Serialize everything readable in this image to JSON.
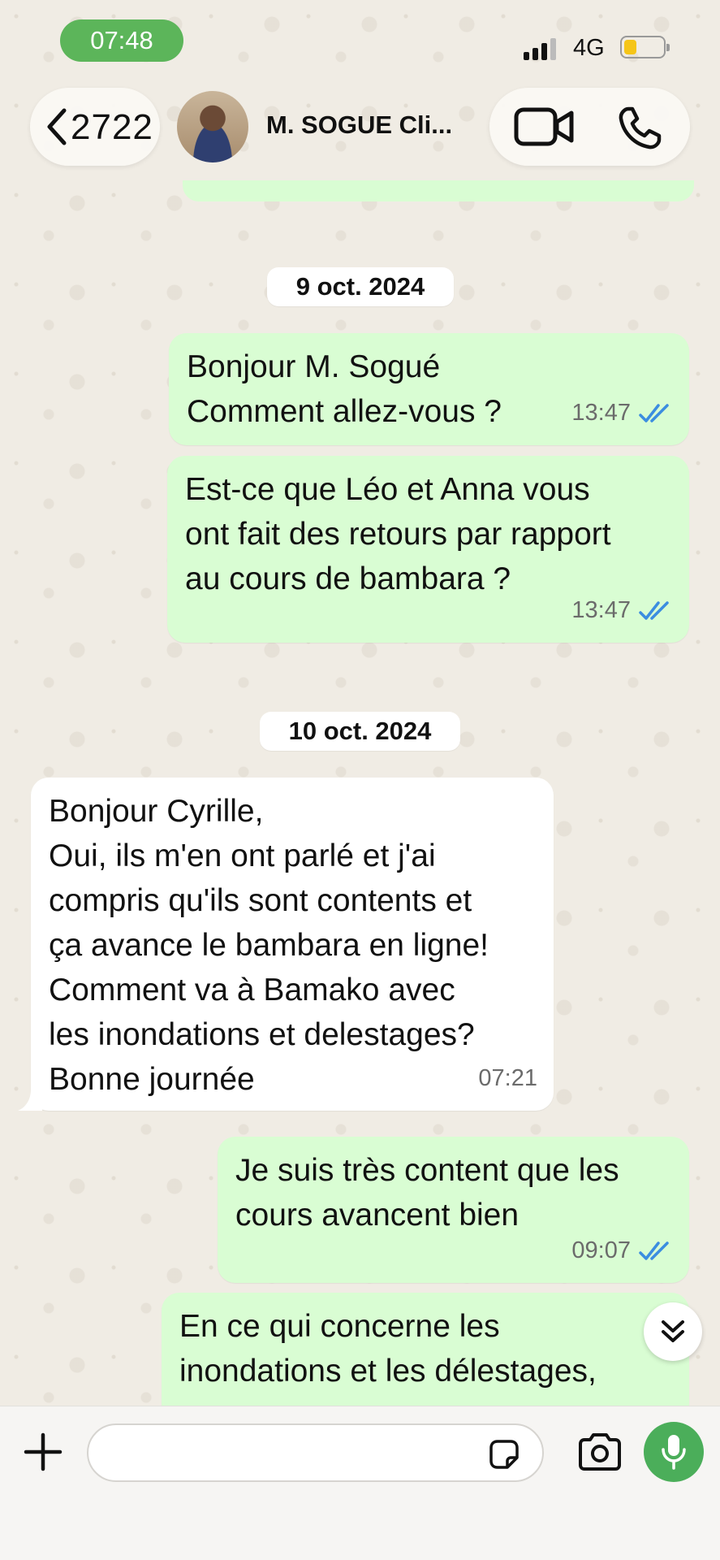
{
  "status_bar": {
    "time": "07:48",
    "network": "4G"
  },
  "header": {
    "back_count": "2722",
    "contact_name": "M. SOGUE Cli..."
  },
  "messages": [
    {
      "type": "date",
      "label": "9 oct. 2024"
    },
    {
      "type": "out",
      "text": "Bonjour M. Sogué\nComment allez-vous ?",
      "time": "13:47",
      "status": "read"
    },
    {
      "type": "out",
      "text": "Est-ce que Léo et Anna vous\nont fait des retours par rapport\nau cours de bambara ?",
      "time": "13:47",
      "status": "read"
    },
    {
      "type": "date",
      "label": "10 oct. 2024"
    },
    {
      "type": "in",
      "text": "Bonjour Cyrille,\nOui, ils m'en ont parlé et j'ai\ncompris qu'ils sont contents et\nça avance le bambara en ligne!\nComment va à Bamako avec\nles inondations et delestages?\nBonne journée",
      "time": "07:21"
    },
    {
      "type": "out",
      "text": "Je suis très content que les\ncours avancent bien",
      "time": "09:07",
      "status": "read"
    },
    {
      "type": "out",
      "text": "En ce qui concerne les\ninondations et les délestages,",
      "time": "",
      "status": ""
    }
  ],
  "input": {
    "placeholder": "",
    "value": ""
  },
  "icons": {
    "back": "chevron-left-icon",
    "video": "video-call-icon",
    "phone": "phone-icon",
    "scroll_down": "double-chevron-down-icon",
    "attach": "plus-icon",
    "sticker": "sticker-icon",
    "camera": "camera-icon",
    "mic": "microphone-icon"
  },
  "colors": {
    "accent": "#4bae5a",
    "outgoing_bubble": "#d9fdd3",
    "incoming_bubble": "#ffffff",
    "read_ticks": "#3b8de0",
    "time_pill": "#5cb55a"
  }
}
